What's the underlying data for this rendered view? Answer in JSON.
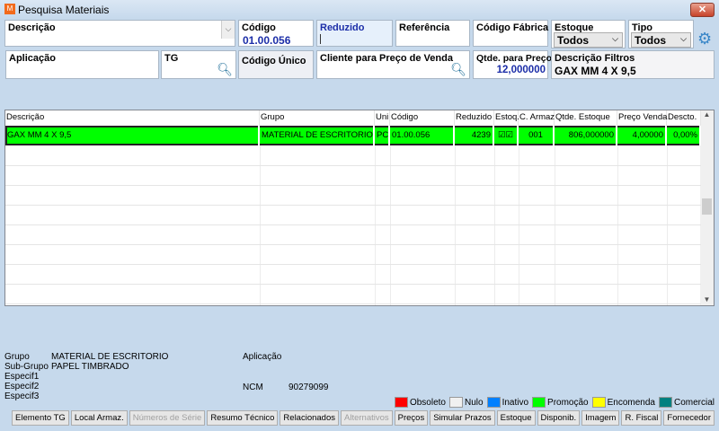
{
  "window": {
    "title": "Pesquisa Materiais",
    "close": "✕"
  },
  "filters": {
    "descricao": {
      "label": "Descrição",
      "value": ""
    },
    "codigo": {
      "label": "Código",
      "value": "01.00.056"
    },
    "reduzido": {
      "label": "Reduzido",
      "value": ""
    },
    "referencia": {
      "label": "Referência",
      "value": ""
    },
    "codigo_fabrica": {
      "label": "Código Fábrica",
      "value": ""
    },
    "estoque": {
      "label": "Estoque",
      "value": "Todos"
    },
    "tipo": {
      "label": "Tipo",
      "value": "Todos"
    },
    "aplicacao": {
      "label": "Aplicação",
      "value": ""
    },
    "tg": {
      "label": "TG",
      "value": ""
    },
    "codigo_unico": {
      "label": "Código Único"
    },
    "cliente": {
      "label": "Cliente para Preço de Venda",
      "value": ""
    },
    "qtde": {
      "label": "Qtde. para Preço",
      "value": "12,000000"
    },
    "descricao_filtros": {
      "label": "Descrição Filtros",
      "value": "GAX MM 4 X 9,5"
    }
  },
  "grid": {
    "columns": [
      "Descrição",
      "Grupo",
      "Uni",
      "Código",
      "Reduzido",
      "Estoq.",
      "C. Armaz",
      "Qtde. Estoque",
      "Preço Venda",
      "Descto."
    ],
    "rows": [
      [
        "GAX MM 4 X 9,5",
        "MATERIAL DE ESCRITORIO",
        "PC",
        "01.00.056",
        "4239",
        "☑☑",
        "001",
        "806,000000",
        "4,00000",
        "0,00%"
      ]
    ],
    "row_color": "#00ff00"
  },
  "details": {
    "grupo_label": "Grupo",
    "grupo": "MATERIAL DE ESCRITORIO",
    "subgrupo_label": "Sub-Grupo",
    "subgrupo": "PAPEL TIMBRADO",
    "especif1": "Especif1",
    "especif2": "Especif2",
    "especif3": "Especif3",
    "aplicacao_label": "Aplicação",
    "ncm_label": "NCM",
    "ncm": "90279099"
  },
  "legend": [
    {
      "label": "Obsoleto",
      "color": "#ff0000"
    },
    {
      "label": "Nulo",
      "color": "#f0f0f0"
    },
    {
      "label": "Inativo",
      "color": "#0080ff"
    },
    {
      "label": "Promoção",
      "color": "#00ff00"
    },
    {
      "label": "Encomenda",
      "color": "#ffff00"
    },
    {
      "label": "Comercial",
      "color": "#008080"
    }
  ],
  "buttons": [
    {
      "label": "Elemento TG",
      "enabled": true
    },
    {
      "label": "Local Armaz.",
      "enabled": true
    },
    {
      "label": "Números de Série",
      "enabled": false
    },
    {
      "label": "Resumo Técnico",
      "enabled": true
    },
    {
      "label": "Relacionados",
      "enabled": true
    },
    {
      "label": "Alternativos",
      "enabled": false
    },
    {
      "label": "Preços",
      "enabled": true
    },
    {
      "label": "Simular Prazos",
      "enabled": true
    },
    {
      "label": "Estoque",
      "enabled": true
    },
    {
      "label": "Disponib.",
      "enabled": true
    },
    {
      "label": "Imagem",
      "enabled": true
    },
    {
      "label": "R. Fiscal",
      "enabled": true
    },
    {
      "label": "Fornecedor",
      "enabled": true
    }
  ]
}
